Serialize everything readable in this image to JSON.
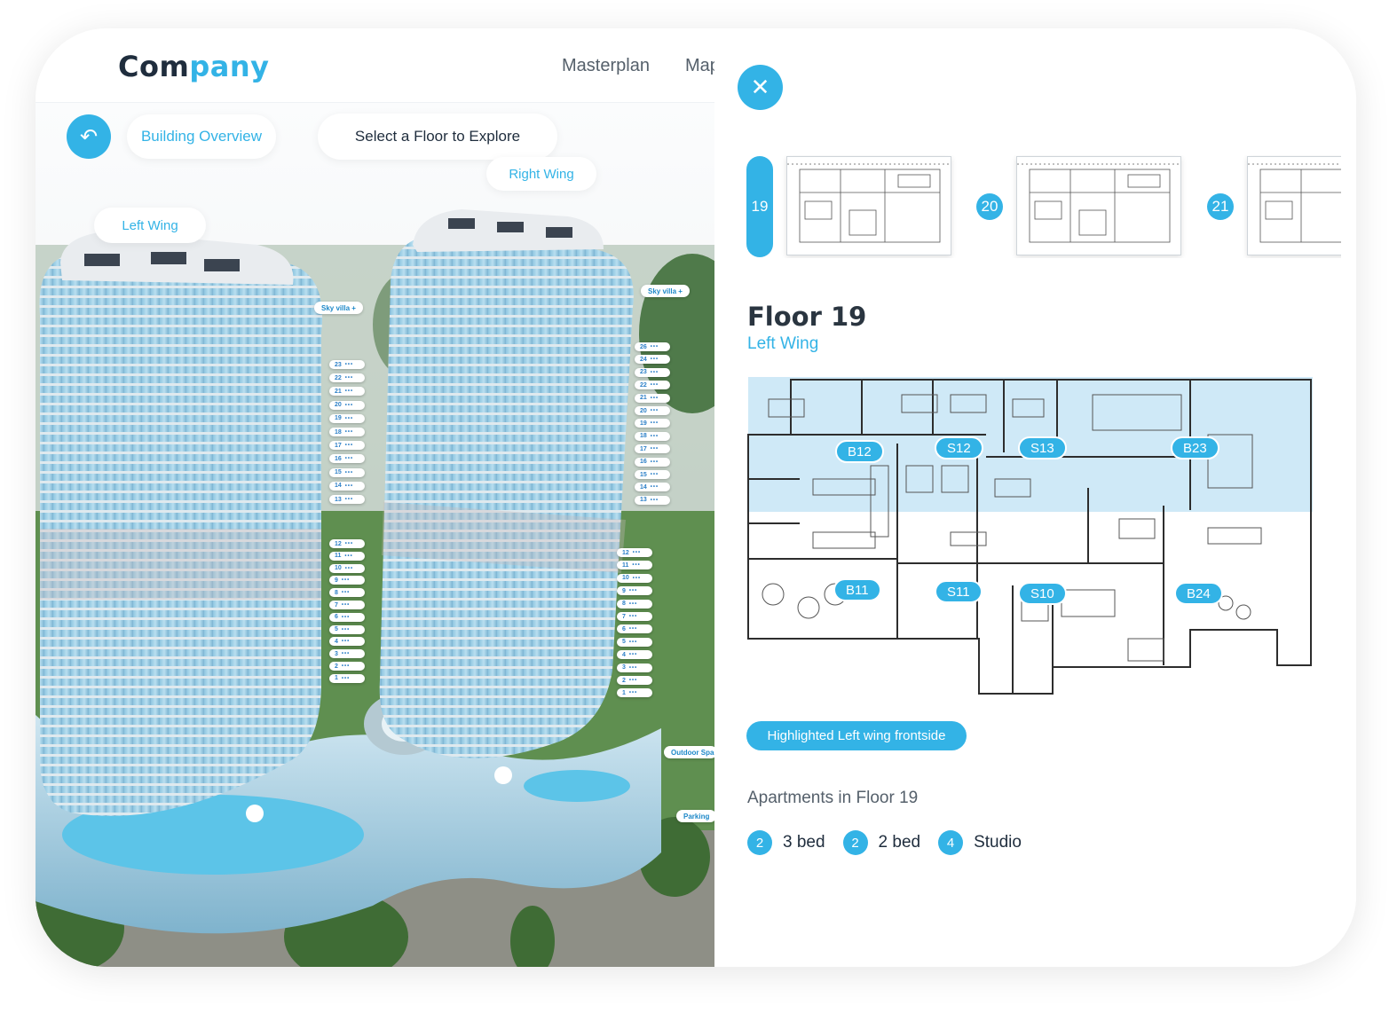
{
  "brand": {
    "part1": "Com",
    "part2": "pany"
  },
  "nav": {
    "masterplan": "Masterplan",
    "map": "Map"
  },
  "scene": {
    "back_label": "Building Overview",
    "instruction": "Select a Floor to Explore",
    "right_wing": "Right Wing",
    "left_wing": "Left  Wing",
    "sky_villa": "Sky villa +",
    "outdoor_space": "Outdoor Space",
    "parking": "Parking",
    "left_floors_upper": [
      "23",
      "22",
      "21",
      "20",
      "19",
      "18",
      "17",
      "16",
      "15",
      "14",
      "13"
    ],
    "left_floors_lower": [
      "12",
      "11",
      "10",
      "9",
      "8",
      "7",
      "6",
      "5",
      "4",
      "3",
      "2",
      "1"
    ],
    "right_floors_upper": [
      "26",
      "24",
      "23",
      "22",
      "21",
      "20",
      "19",
      "18",
      "17",
      "16",
      "15",
      "14",
      "13"
    ],
    "right_floors_lower": [
      "12",
      "11",
      "10",
      "9",
      "8",
      "7",
      "6",
      "5",
      "4",
      "3",
      "2",
      "1"
    ]
  },
  "panel": {
    "floors": [
      "19",
      "20",
      "21"
    ],
    "active_floor": "19",
    "title": "Floor 19",
    "subtitle": "Left Wing",
    "units": [
      "B12",
      "S12",
      "S13",
      "B23",
      "B11",
      "S11",
      "S10",
      "B24"
    ],
    "highlight_button": "Highlighted Left wing frontside",
    "apartments_title": "Apartments in Floor 19",
    "apartments": [
      {
        "count": "2",
        "type": "3 bed"
      },
      {
        "count": "2",
        "type": "2 bed"
      },
      {
        "count": "4",
        "type": "Studio"
      }
    ]
  },
  "colors": {
    "accent": "#33b3e6",
    "dark": "#1f2d3d",
    "highlight": "#cfe9f7"
  }
}
